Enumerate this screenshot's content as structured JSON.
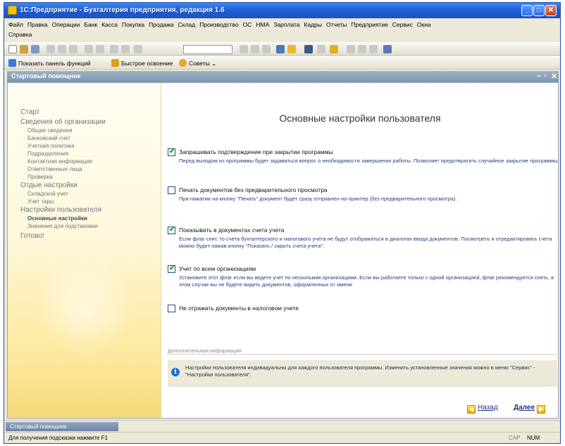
{
  "window": {
    "title": "1С:Предприятие - Бухгалтерия предприятия, редакция 1.6"
  },
  "menu": {
    "row1": [
      "Файл",
      "Правка",
      "Операции",
      "Банк",
      "Касса",
      "Покупка",
      "Продажа",
      "Склад",
      "Производство",
      "ОС",
      "НМА",
      "Зарплата",
      "Кадры",
      "Отчеты",
      "Предприятие",
      "Сервис",
      "Окна"
    ],
    "row2": [
      "Справка"
    ]
  },
  "toolbar2": {
    "functions_panel": "Показать панель функций",
    "quick_setup": "Быстрое освоение",
    "tips": "Советы"
  },
  "panel": {
    "title": "Стартовый помощник"
  },
  "nav": {
    "items": [
      {
        "label": "Старт",
        "level": 0
      },
      {
        "label": "Сведения об организации",
        "level": 0
      },
      {
        "label": "Общие сведения",
        "level": 1
      },
      {
        "label": "Банковский счет",
        "level": 1
      },
      {
        "label": "Учетная политика",
        "level": 1
      },
      {
        "label": "Подразделения",
        "level": 1
      },
      {
        "label": "Контактная информация",
        "level": 1
      },
      {
        "label": "Ответственные лица",
        "level": 1
      },
      {
        "label": "Проверка",
        "level": 1
      },
      {
        "label": "Отдые настройки",
        "level": 0
      },
      {
        "label": "Складской учет",
        "level": 1
      },
      {
        "label": "Учет тары",
        "level": 1
      },
      {
        "label": "Настройки пользователя",
        "level": 0
      },
      {
        "label": "Основные настройки",
        "level": 1,
        "active": true
      },
      {
        "label": "Значения для подстановки",
        "level": 1
      },
      {
        "label": "Готово!",
        "level": 0
      }
    ]
  },
  "main": {
    "heading": "Основные настройки пользователя",
    "options": [
      {
        "label": "Запрашивать подтверждение при закрытии программы",
        "checked": "✔",
        "desc": "Перед выходом из программы будет задаваться вопрос о необходимости завершения работы. Позволяет предотвратить случайное закрытие программы."
      },
      {
        "label": "Печать документов без предварительного просмотра",
        "checked": "",
        "desc": "При нажатии на кнопку \"Печать\" документ будет сразу отправлен на принтер (без предварительного просмотра)."
      },
      {
        "label": "Показывать в документах счета учета",
        "checked": "✔",
        "desc": "Если флаг снят, то счета бухгалтерского и налогового учета не будут отображаться в диалогах ввода документов. Посмотреть и отредактировать счета можно будет нажав кнопку \"Показать / скрыть счета учета\"."
      },
      {
        "label": "Учет по всем организациям",
        "checked": "✔",
        "desc": "Установите этот флаг если вы ведете учет по нескольким организациям. Если вы работаете только с одной организацией, флаг рекомендуется снять, в этом случае вы не будете видеть документов, оформленных от имени"
      },
      {
        "label": "Не отражать документы в налоговом учете",
        "checked": "",
        "desc": ""
      }
    ],
    "additional_label": "Дополнительная информация",
    "info_text": "Настройки пользователя индивидуальны для каждого пользователя программы. Изменить установленные значения можно в меню \"Сервис\" - \"Настройки пользователя\".",
    "back_button": "Назад",
    "next_button": "Далее"
  },
  "taskbar": {
    "tab": "Стартовый помощник"
  },
  "status": {
    "hint": "Для получения подсказки нажмите F1",
    "cap": "CAP",
    "num": "NUM"
  }
}
